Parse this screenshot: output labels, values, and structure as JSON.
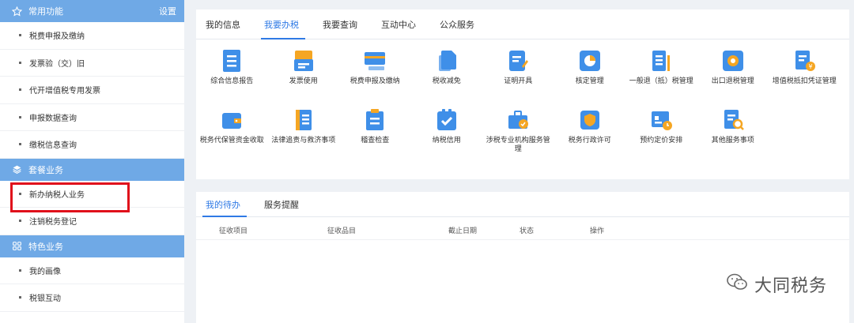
{
  "sidebar": {
    "section_common": {
      "title": "常用功能",
      "setting": "设置"
    },
    "common_items": [
      "税费申报及缴纳",
      "发票验（交）旧",
      "代开增值税专用发票",
      "申报数据查询",
      "缴税信息查询"
    ],
    "section_package": {
      "title": "套餐业务"
    },
    "package_items": [
      "新办纳税人业务",
      "注销税务登记"
    ],
    "section_special": {
      "title": "特色业务"
    },
    "special_items": [
      "我的画像",
      "税银互动"
    ]
  },
  "top_panel": {
    "tabs": [
      "我的信息",
      "我要办税",
      "我要查询",
      "互动中心",
      "公众服务"
    ],
    "active_tab": "我要办税",
    "services": [
      {
        "label": "综合信息报告",
        "icon": "report-icon"
      },
      {
        "label": "发票使用",
        "icon": "invoice-icon"
      },
      {
        "label": "税费申报及缴纳",
        "icon": "card-icon"
      },
      {
        "label": "税收减免",
        "icon": "documents-icon"
      },
      {
        "label": "证明开具",
        "icon": "pen-document-icon"
      },
      {
        "label": "核定管理",
        "icon": "pie-chart-icon"
      },
      {
        "label": "一般退（抵）税管理",
        "icon": "list-document-icon"
      },
      {
        "label": "出口退税管理",
        "icon": "gear-icon"
      },
      {
        "label": "增值税抵扣凭证管理",
        "icon": "yen-document-icon"
      },
      {
        "label": "税务代保管资金收取",
        "icon": "wallet-icon"
      },
      {
        "label": "法律追责与救济事项",
        "icon": "book-icon"
      },
      {
        "label": "稽查检查",
        "icon": "clipboard-icon"
      },
      {
        "label": "纳税信用",
        "icon": "check-icon"
      },
      {
        "label": "涉税专业机构服务管理",
        "icon": "briefcase-icon"
      },
      {
        "label": "税务行政许可",
        "icon": "shield-icon"
      },
      {
        "label": "预约定价安排",
        "icon": "calendar-clock-icon"
      },
      {
        "label": "其他服务事项",
        "icon": "search-document-icon"
      }
    ]
  },
  "bottom_panel": {
    "tabs": [
      "我的待办",
      "服务提醒"
    ],
    "active_tab": "我的待办",
    "columns": [
      "征收项目",
      "征收品目",
      "截止日期",
      "状态",
      "操作"
    ]
  },
  "watermark": {
    "text": "大同税务",
    "icon": "wechat-icon"
  },
  "colors": {
    "accent": "#2f7ae5",
    "sidebar_header": "#6fa9e6",
    "highlight_border": "#e0101b",
    "icon_blue": "#3f8fe8",
    "icon_orange": "#f5a623"
  }
}
